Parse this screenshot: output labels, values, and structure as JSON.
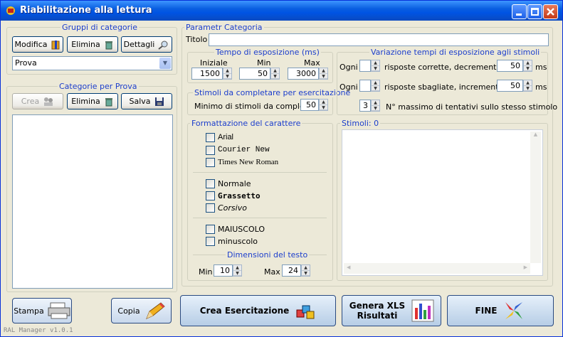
{
  "window": {
    "title": "Riabilitazione alla lettura",
    "version": "RAL Manager v1.0.1"
  },
  "gruppi": {
    "title": "Gruppi di categorie",
    "modifica": "Modifica",
    "elimina": "Elimina",
    "dettagli": "Dettagli",
    "selected": "Prova"
  },
  "categorie": {
    "title": "Categorie per Prova",
    "crea": "Crea",
    "elimina": "Elimina",
    "salva": "Salva"
  },
  "params": {
    "title": "Parametr Categoria",
    "titolo_label": "Titolo",
    "titolo_value": ""
  },
  "tempo": {
    "title": "Tempo di esposizione (ms)",
    "iniziale_label": "Iniziale",
    "min_label": "Min",
    "max_label": "Max",
    "iniziale": "1500",
    "min": "50",
    "max": "3000"
  },
  "stimoli_compl": {
    "title": "Stimoli da completare per esercitazione",
    "label": "Minimo di stimoli da completare",
    "value": "50"
  },
  "variazione": {
    "title": "Variazione tempi di esposizione agli stimoli",
    "ogni1": "Ogni",
    "corr_text": "risposte corrette, decrementa di",
    "corr_ms": "50",
    "ogni2": "Ogni",
    "sbag_text": "risposte sbagliate, incrementa di",
    "sbag_ms": "50",
    "ms": "ms",
    "tent_value": "3",
    "tent_text": "N° massimo di tentativi sullo stesso stimolo"
  },
  "formattazione": {
    "title": "Formattazione del carattere",
    "fonts": [
      "Arial",
      "Courier New",
      "Times New Roman"
    ],
    "styles": [
      "Normale",
      "Grassetto",
      "Corsivo"
    ],
    "cases": [
      "MAIUSCOLO",
      "minuscolo"
    ],
    "dim_title": "Dimensioni del testo",
    "min_label": "Min",
    "min_value": "10",
    "max_label": "Max",
    "max_value": "24"
  },
  "stimoli": {
    "title": "Stimoli: 0"
  },
  "footer": {
    "stampa": "Stampa",
    "copia": "Copia",
    "crea_eserc": "Crea Esercitazione",
    "genera": "Genera XLS Risultati",
    "fine": "FINE"
  }
}
